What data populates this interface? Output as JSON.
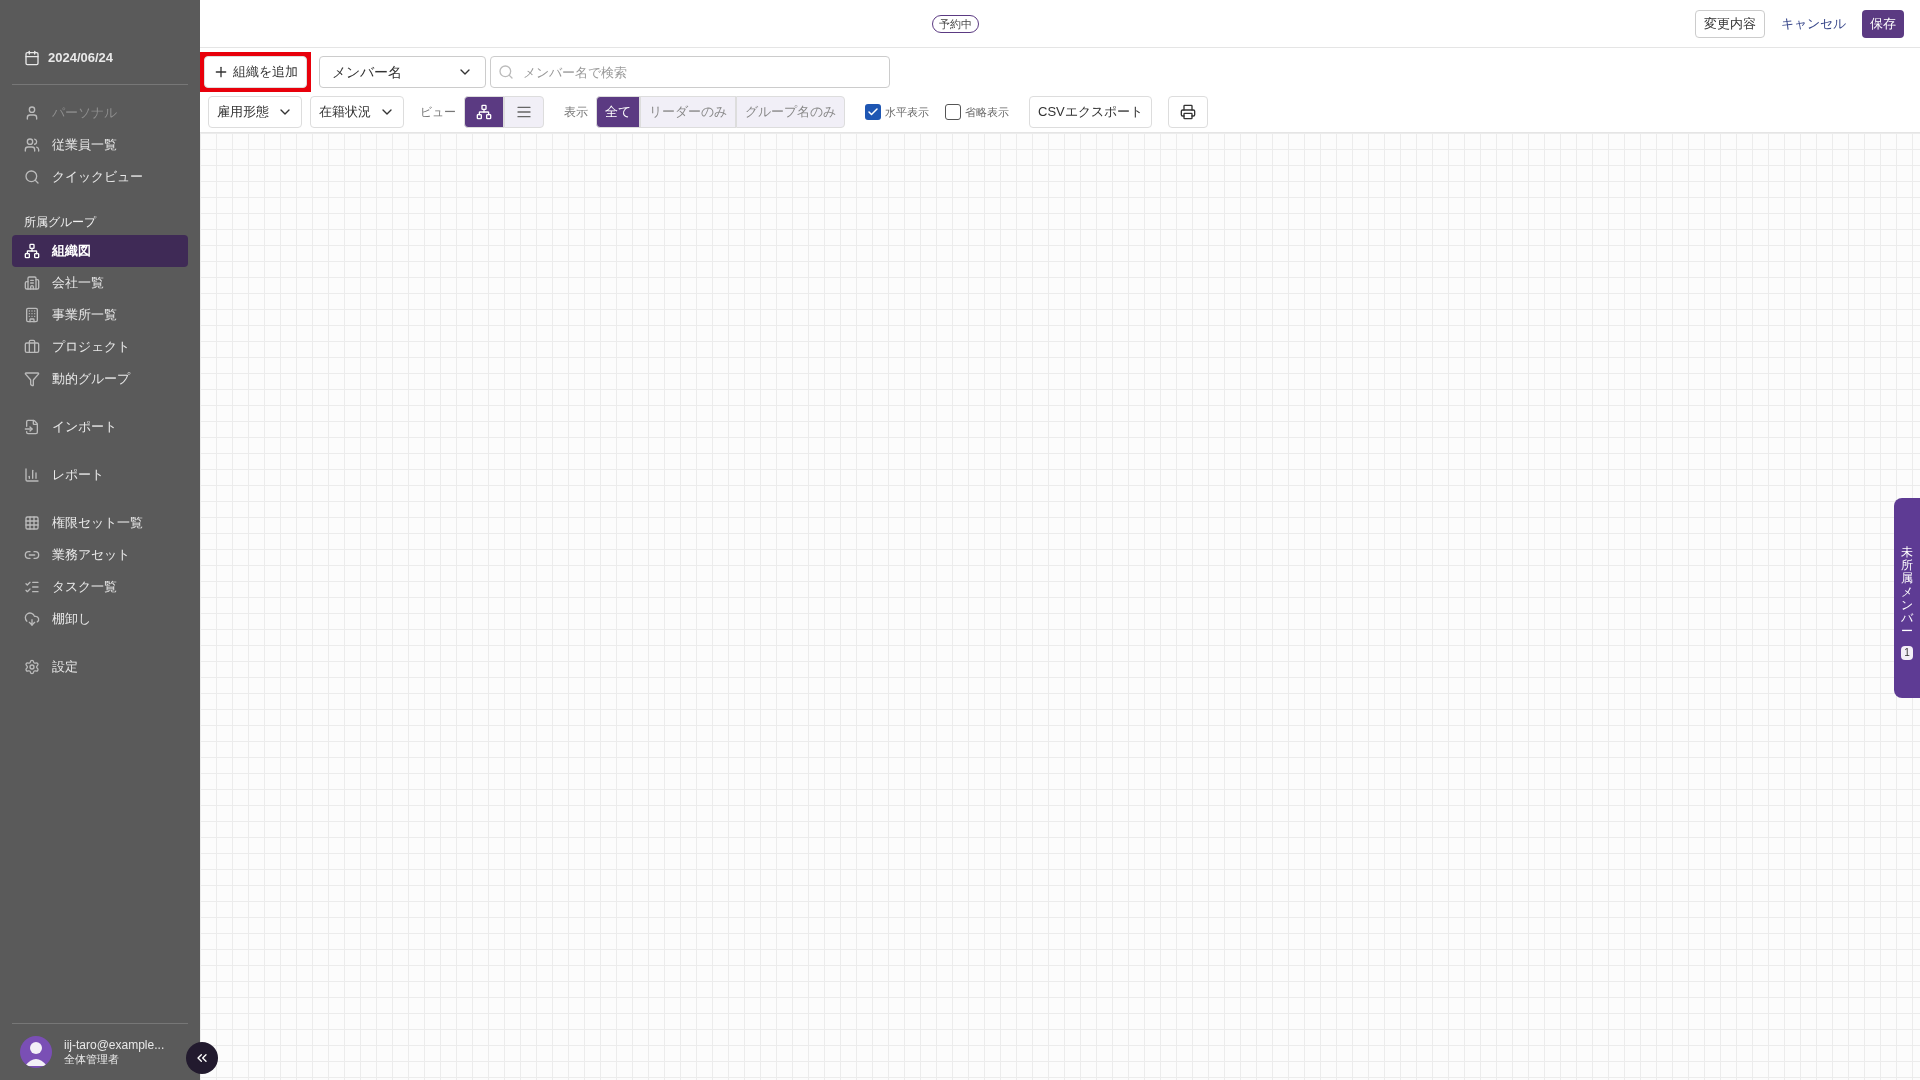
{
  "sidebar": {
    "date": "2024/06/24",
    "groups": [
      {
        "items": [
          {
            "label": "パーソナル",
            "selected": false,
            "disabled": true
          },
          {
            "label": "従業員一覧",
            "selected": false,
            "disabled": false
          },
          {
            "label": "クイックビュー",
            "selected": false,
            "disabled": false
          }
        ]
      },
      {
        "heading": "所属グループ",
        "items": [
          {
            "label": "組織図",
            "selected": true,
            "disabled": false
          },
          {
            "label": "会社一覧",
            "selected": false,
            "disabled": false
          },
          {
            "label": "事業所一覧",
            "selected": false,
            "disabled": false
          },
          {
            "label": "プロジェクト",
            "selected": false,
            "disabled": false
          },
          {
            "label": "動的グループ",
            "selected": false,
            "disabled": false
          }
        ]
      },
      {
        "items": [
          {
            "label": "インポート",
            "selected": false,
            "disabled": false
          }
        ]
      },
      {
        "items": [
          {
            "label": "レポート",
            "selected": false,
            "disabled": false
          }
        ]
      },
      {
        "items": [
          {
            "label": "権限セット一覧",
            "selected": false,
            "disabled": false
          },
          {
            "label": "業務アセット",
            "selected": false,
            "disabled": false
          },
          {
            "label": "タスク一覧",
            "selected": false,
            "disabled": false
          },
          {
            "label": "棚卸し",
            "selected": false,
            "disabled": false
          }
        ]
      },
      {
        "items": [
          {
            "label": "設定",
            "selected": false,
            "disabled": false
          }
        ]
      }
    ],
    "user": {
      "email": "iij-taro@example...",
      "role": "全体管理者"
    }
  },
  "header": {
    "badge": "予約中",
    "buttons": [
      {
        "label": "変更内容",
        "kind": "outline"
      },
      {
        "label": "キャンセル",
        "kind": "link"
      },
      {
        "label": "保存",
        "kind": "primary"
      }
    ]
  },
  "toolbar": {
    "add_button": {
      "label": "組織を追加",
      "highlighted": true
    },
    "search_by": "メンバー名",
    "search": {
      "placeholder": "メンバー名で検索"
    },
    "filters": [
      "雇用形態",
      "在籍状況"
    ],
    "view_label": "ビュー",
    "view_modes": [
      {
        "selected": true
      },
      {
        "selected": false
      }
    ],
    "display_label": "表示",
    "display_options": [
      {
        "label": "全て",
        "selected": true
      },
      {
        "label": "リーダーのみ",
        "selected": false
      },
      {
        "label": "グループ名のみ",
        "selected": false
      }
    ],
    "checkboxes": [
      {
        "label": "水平表示",
        "checked": true
      },
      {
        "label": "省略表示",
        "checked": false
      }
    ],
    "export_button": "CSVエクスポート"
  },
  "unassigned_tab": {
    "label": "未所属メンバー",
    "count": "1"
  }
}
